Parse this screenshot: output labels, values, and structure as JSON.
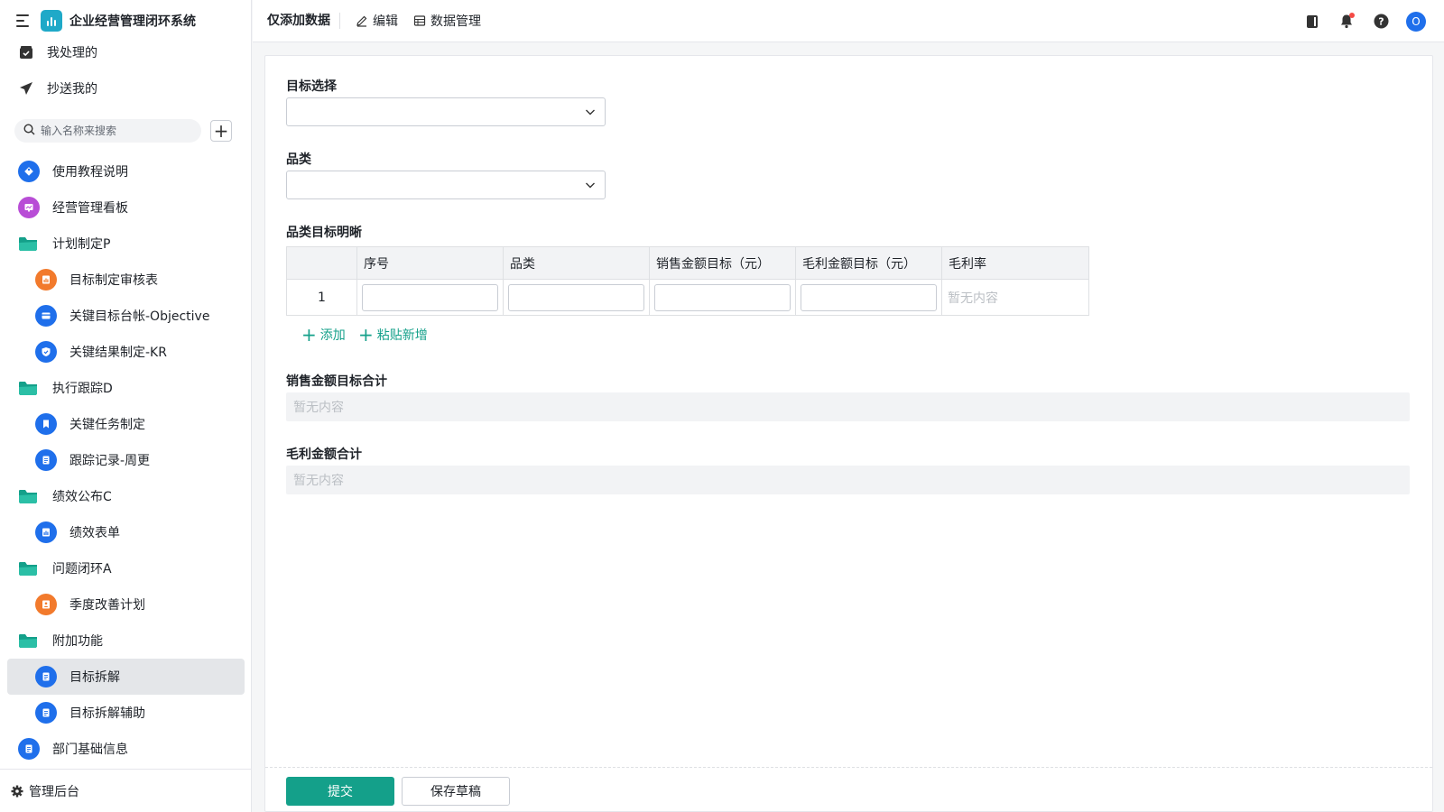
{
  "app": {
    "title": "企业经营管理闭环系统",
    "logo_color": "#1fa9c8"
  },
  "sidebar": {
    "top_items": [
      {
        "label": "我处理的",
        "icon": "inbox-check-icon"
      },
      {
        "label": "抄送我的",
        "icon": "paper-plane-icon"
      }
    ],
    "search": {
      "placeholder": "输入名称来搜索"
    },
    "add_label": "+",
    "items": [
      {
        "label": "使用教程说明",
        "type": "app",
        "color": "#1f6feb",
        "icon": "tag-icon"
      },
      {
        "label": "经营管理看板",
        "type": "app",
        "color": "#b84dd6",
        "icon": "dashboard-icon"
      },
      {
        "label": "计划制定P",
        "type": "folder",
        "icon": "folder-icon"
      },
      {
        "label": "目标制定审核表",
        "type": "app",
        "color": "#f27a2c",
        "icon": "chart-sheet-icon",
        "child": true
      },
      {
        "label": "关键目标台帐-Objective",
        "type": "app",
        "color": "#1f6feb",
        "icon": "card-icon",
        "child": true
      },
      {
        "label": "关键结果制定-KR",
        "type": "app",
        "color": "#1f6feb",
        "icon": "shield-check-icon",
        "child": true
      },
      {
        "label": "执行跟踪D",
        "type": "folder",
        "icon": "folder-icon"
      },
      {
        "label": "关键任务制定",
        "type": "app",
        "color": "#1f6feb",
        "icon": "bookmark-icon",
        "child": true
      },
      {
        "label": "跟踪记录-周更",
        "type": "app",
        "color": "#1f6feb",
        "icon": "document-icon",
        "child": true
      },
      {
        "label": "绩效公布C",
        "type": "folder",
        "icon": "folder-icon"
      },
      {
        "label": "绩效表单",
        "type": "app",
        "color": "#1f6feb",
        "icon": "chart-sheet-icon",
        "child": true
      },
      {
        "label": "问题闭环A",
        "type": "folder",
        "icon": "folder-icon"
      },
      {
        "label": "季度改善计划",
        "type": "app",
        "color": "#f27a2c",
        "icon": "person-sheet-icon",
        "child": true
      },
      {
        "label": "附加功能",
        "type": "folder",
        "icon": "folder-icon"
      },
      {
        "label": "目标拆解",
        "type": "app",
        "color": "#1f6feb",
        "icon": "document-icon",
        "child": true,
        "active": true
      },
      {
        "label": "目标拆解辅助",
        "type": "app",
        "color": "#1f6feb",
        "icon": "document-icon",
        "child": true
      },
      {
        "label": "部门基础信息",
        "type": "app",
        "color": "#1f6feb",
        "icon": "document-icon"
      }
    ],
    "footer": {
      "label": "管理后台",
      "icon": "gear-icon"
    }
  },
  "topbar": {
    "title": "仅添加数据",
    "edit_label": "编辑",
    "data_manage_label": "数据管理"
  },
  "form": {
    "target_select_label": "目标选择",
    "target_select_value": "",
    "category_label": "品类",
    "category_value": "",
    "detail_label": "品类目标明晰",
    "table": {
      "columns": [
        "序号",
        "品类",
        "销售金额目标（元）",
        "毛利金额目标（元）",
        "毛利率"
      ],
      "rows": [
        {
          "index": "1",
          "category": "",
          "sales_target": "",
          "profit_target": "",
          "margin": "暂无内容"
        }
      ]
    },
    "add_label": "添加",
    "paste_add_label": "粘贴新增",
    "sales_total_label": "销售金额目标合计",
    "sales_total_value": "暂无内容",
    "profit_total_label": "毛利金额合计",
    "profit_total_value": "暂无内容",
    "submit_label": "提交",
    "save_draft_label": "保存草稿"
  },
  "colors": {
    "accent": "#14a08a",
    "blue": "#1f6feb",
    "orange": "#f27a2c",
    "folder": "#14a08a"
  }
}
